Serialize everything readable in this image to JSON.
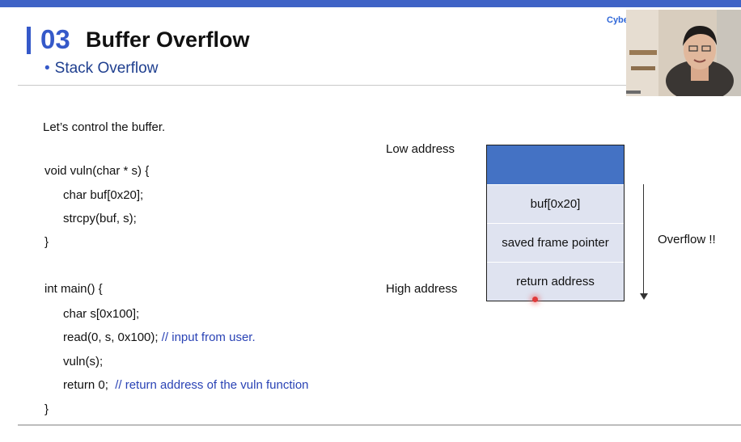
{
  "slide": {
    "number": "03",
    "title": "Buffer Overflow",
    "subtitle": "Stack Overflow",
    "brand": "Cybe"
  },
  "intro": "Let’s control the buffer.",
  "code": {
    "lines": [
      {
        "text": "void vuln(char * s) {",
        "comment": ""
      },
      {
        "text": "char buf[0x20];",
        "comment": ""
      },
      {
        "text": "strcpy(buf, s);",
        "comment": ""
      },
      {
        "text": "}",
        "comment": ""
      },
      {
        "text": "int main() {",
        "comment": ""
      },
      {
        "text": "char s[0x100];",
        "comment": ""
      },
      {
        "text": "read(0, s, 0x100); ",
        "comment": "// input from user."
      },
      {
        "text": "vuln(s);",
        "comment": ""
      },
      {
        "text": "return 0;  ",
        "comment": "// return address of the vuln function"
      },
      {
        "text": "}",
        "comment": ""
      }
    ]
  },
  "diagram": {
    "low_address": "Low address",
    "high_address": "High address",
    "cells": [
      "",
      "buf[0x20]",
      "saved frame pointer",
      "return address"
    ],
    "overflow_label": "Overflow !!",
    "colors": {
      "top_block": "#4472c4",
      "cell_fill": "#dfe3f0",
      "accent": "#3559c9"
    }
  }
}
